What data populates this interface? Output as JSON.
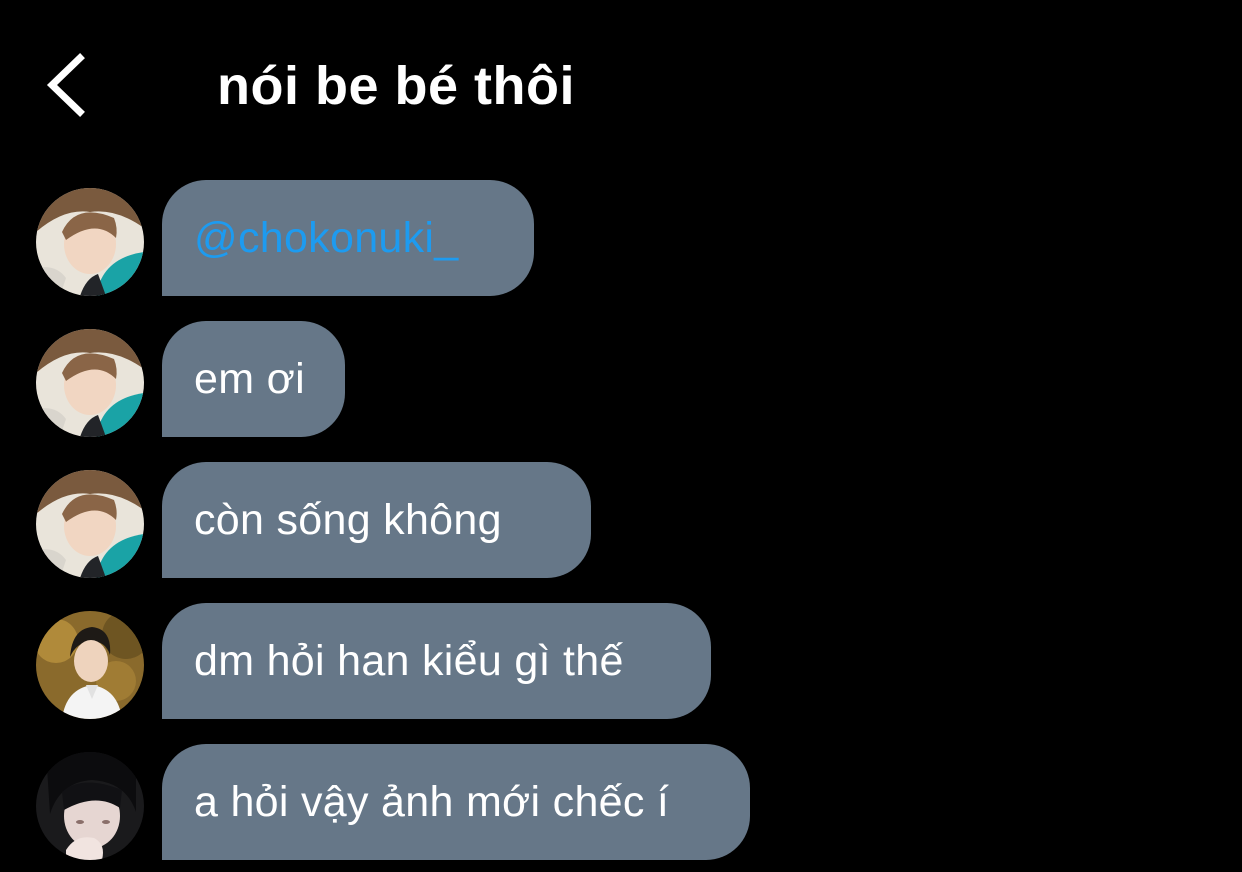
{
  "header": {
    "title": "nói be bé thôi",
    "back_icon": "chevron-left-icon"
  },
  "colors": {
    "background": "#000000",
    "bubble": "#667788",
    "text": "#ffffff",
    "mention": "#1d9bf0"
  },
  "messages": [
    {
      "sender": "user-a",
      "text": "@chokonuki_",
      "is_mention": true
    },
    {
      "sender": "user-a",
      "text": "em ơi",
      "is_mention": false
    },
    {
      "sender": "user-a",
      "text": "còn sống không",
      "is_mention": false
    },
    {
      "sender": "user-b",
      "text": "dm hỏi han kiểu gì thế",
      "is_mention": false
    },
    {
      "sender": "user-c",
      "text": "a hỏi vậy ảnh mới chếc í",
      "is_mention": false
    }
  ]
}
